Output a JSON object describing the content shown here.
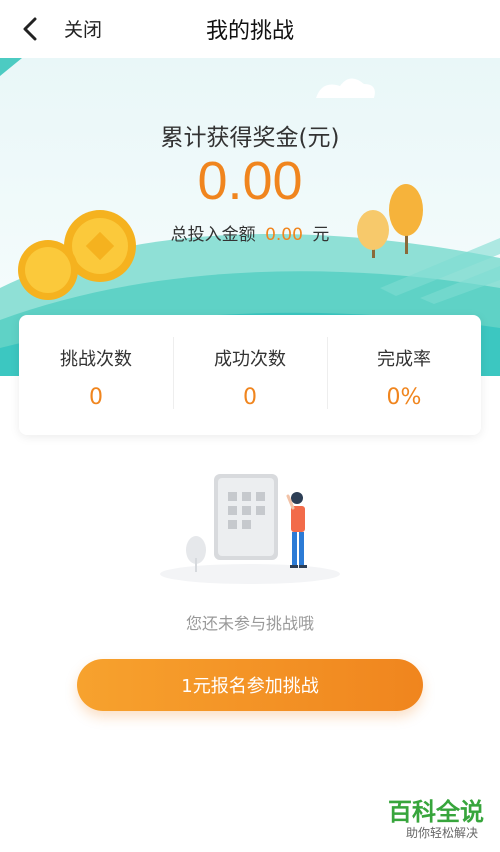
{
  "header": {
    "back_icon": "chevron-left-icon",
    "close_label": "关闭",
    "title": "我的挑战"
  },
  "summary": {
    "prize_label": "累计获得奖金(元)",
    "prize_value": "0.00",
    "invest_prefix": "总投入金额",
    "invest_value": "0.00",
    "invest_unit": "元"
  },
  "stats": [
    {
      "label": "挑战次数",
      "value": "0"
    },
    {
      "label": "成功次数",
      "value": "0"
    },
    {
      "label": "完成率",
      "value": "0%"
    }
  ],
  "empty_state": {
    "illustration": "person-with-phone-illustration",
    "message": "您还未参与挑战哦"
  },
  "cta": {
    "label": "1元报名参加挑战"
  },
  "watermark": {
    "title": "百科全说",
    "subtitle": "助你轻松解决"
  },
  "colors": {
    "accent": "#f0851e",
    "teal": "#3cc7c1",
    "watermark_green": "#37a53c"
  }
}
